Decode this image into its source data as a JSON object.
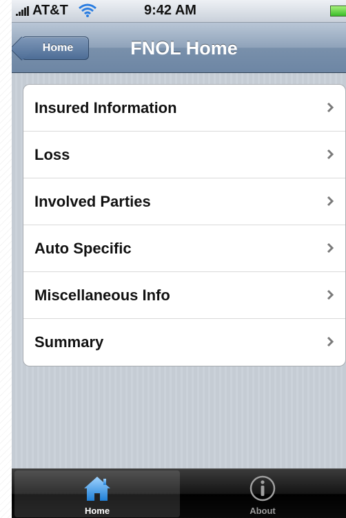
{
  "status_bar": {
    "carrier": "AT&T",
    "time": "9:42 AM"
  },
  "nav": {
    "back_label": "Home",
    "title": "FNOL Home"
  },
  "menu": {
    "items": [
      {
        "label": "Insured Information"
      },
      {
        "label": "Loss"
      },
      {
        "label": "Involved Parties"
      },
      {
        "label": "Auto Specific"
      },
      {
        "label": "Miscellaneous Info"
      },
      {
        "label": "Summary"
      }
    ]
  },
  "tab_bar": {
    "tabs": [
      {
        "label": "Home",
        "icon": "home-icon",
        "selected": true
      },
      {
        "label": "About",
        "icon": "info-icon",
        "selected": false
      }
    ]
  },
  "colors": {
    "nav_bar": "#7990ab",
    "active_tab_icon": "#4aa3e8"
  }
}
